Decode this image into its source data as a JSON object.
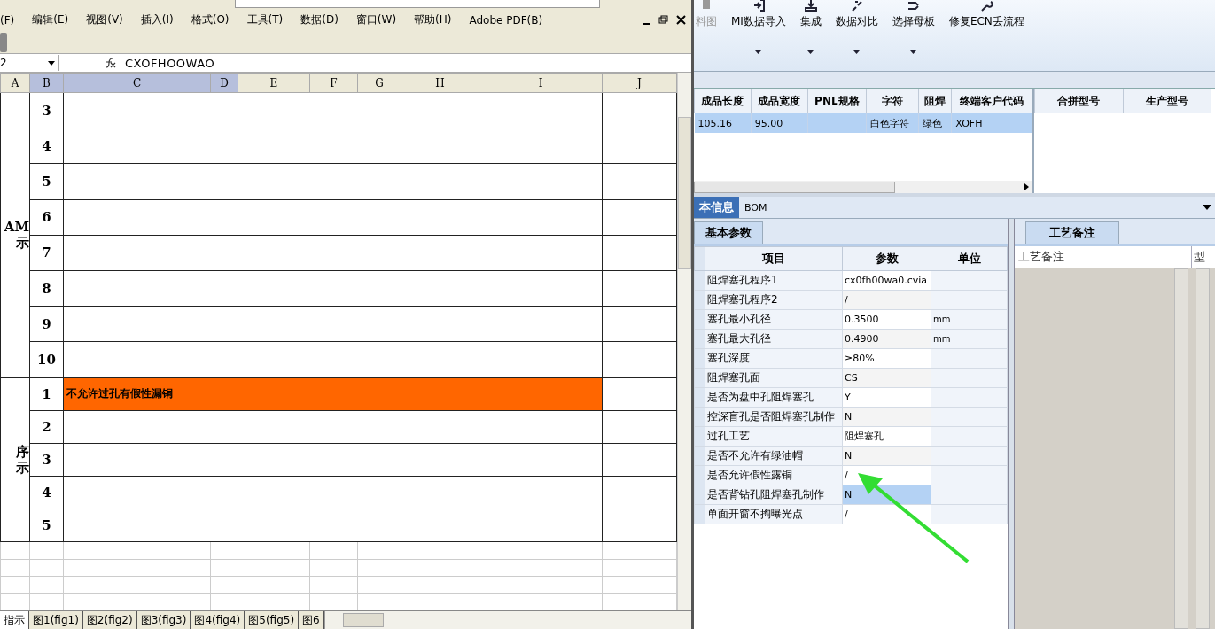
{
  "excel": {
    "menu": [
      "(F)",
      "编辑(E)",
      "视图(V)",
      "插入(I)",
      "格式(O)",
      "工具(T)",
      "数据(D)",
      "窗口(W)",
      "帮助(H)",
      "Adobe PDF(B)"
    ],
    "name_box": "2",
    "formula": "CXOFHOOWAO",
    "columns": [
      {
        "label": "A",
        "selected": false
      },
      {
        "label": "B",
        "selected": true
      },
      {
        "label": "C",
        "selected": true
      },
      {
        "label": "D",
        "selected": true
      },
      {
        "label": "E",
        "selected": false
      },
      {
        "label": "F",
        "selected": false
      },
      {
        "label": "G",
        "selected": false
      },
      {
        "label": "H",
        "selected": false
      },
      {
        "label": "I",
        "selected": false
      },
      {
        "label": "J",
        "selected": false
      }
    ],
    "groups": [
      {
        "label_lines": [
          "AM",
          "示"
        ],
        "rows": [
          {
            "num": "3",
            "highlighted": false
          },
          {
            "num": "4",
            "highlighted": false
          },
          {
            "num": "5",
            "highlighted": false
          },
          {
            "num": "6",
            "highlighted": false
          },
          {
            "num": "7",
            "highlighted": false
          },
          {
            "num": "8",
            "highlighted": false
          },
          {
            "num": "9",
            "highlighted": false
          },
          {
            "num": "10",
            "highlighted": false
          }
        ]
      },
      {
        "label_lines": [
          "序",
          "示"
        ],
        "rows": [
          {
            "num": "1",
            "text": "不允许过孔有假性漏铜",
            "highlighted": true
          },
          {
            "num": "2",
            "highlighted": false
          },
          {
            "num": "3",
            "highlighted": false
          },
          {
            "num": "4",
            "highlighted": false
          },
          {
            "num": "5",
            "highlighted": false
          }
        ]
      }
    ],
    "sheet_tabs": [
      {
        "label": "指示",
        "selected": true
      },
      {
        "label": "图1(fig1)",
        "selected": false
      },
      {
        "label": "图2(fig2)",
        "selected": false
      },
      {
        "label": "图3(fig3)",
        "selected": false
      },
      {
        "label": "图4(fig4)",
        "selected": false
      },
      {
        "label": "图5(fig5)",
        "selected": false
      },
      {
        "label": "图6",
        "selected": false
      }
    ]
  },
  "app": {
    "ribbon": [
      {
        "label": "料图",
        "disabled": true,
        "has_menu": false
      },
      {
        "label": "MI数据导入",
        "disabled": false,
        "has_menu": true
      },
      {
        "label": "集成",
        "disabled": false,
        "has_menu": true
      },
      {
        "label": "数据对比",
        "disabled": false,
        "has_menu": true
      },
      {
        "label": "选择母板",
        "disabled": false,
        "has_menu": true
      },
      {
        "label": "修复ECN丢流程",
        "disabled": false,
        "has_menu": false
      }
    ],
    "grid": {
      "columns": [
        "成品长度",
        "成品宽度",
        "PNL规格",
        "字符",
        "阻焊",
        "终端客户代码"
      ],
      "rows": [
        {
          "cells": [
            "105.16",
            "95.00",
            "",
            "白色字符",
            "绿色",
            "XOFH"
          ],
          "selected": true
        }
      ]
    },
    "side_grid": {
      "columns": [
        "合拼型号",
        "生产型号"
      ]
    },
    "tabs": [
      {
        "label": "本信息",
        "selected": true
      },
      {
        "label": "BOM",
        "selected": false
      }
    ],
    "params": {
      "tab": "基本参数",
      "columns": [
        "项目",
        "参数",
        "单位"
      ],
      "rows": [
        {
          "item": "阻焊塞孔程序1",
          "value": "cx0fh00wa0.cvia",
          "selected": false
        },
        {
          "item": "阻焊塞孔程序2",
          "value": "/",
          "selected": false
        },
        {
          "item": "塞孔最小孔径",
          "value": "0.3500",
          "unit": "mm",
          "selected": false
        },
        {
          "item": "塞孔最大孔径",
          "value": "0.4900",
          "unit": "mm",
          "selected": false
        },
        {
          "item": "塞孔深度",
          "value": "≥80%",
          "selected": false
        },
        {
          "item": "阻焊塞孔面",
          "value": "CS",
          "selected": false
        },
        {
          "item": "是否为盘中孔阻焊塞孔",
          "value": "Y",
          "selected": false
        },
        {
          "item": "控深盲孔是否阻焊塞孔制作",
          "value": "N",
          "selected": false
        },
        {
          "item": "过孔工艺",
          "value": "阻焊塞孔",
          "selected": false
        },
        {
          "item": "是否不允许有绿油帽",
          "value": "N",
          "selected": false
        },
        {
          "item": "是否允许假性露铜",
          "value": "/",
          "selected": false
        },
        {
          "item": "是否背钻孔阻焊塞孔制作",
          "value": "N",
          "selected": true
        },
        {
          "item": "单面开窗不掏曝光点",
          "value": "/",
          "selected": false
        }
      ]
    },
    "notes": {
      "tab": "工艺备注",
      "columns": [
        "工艺备注",
        "型"
      ]
    }
  }
}
